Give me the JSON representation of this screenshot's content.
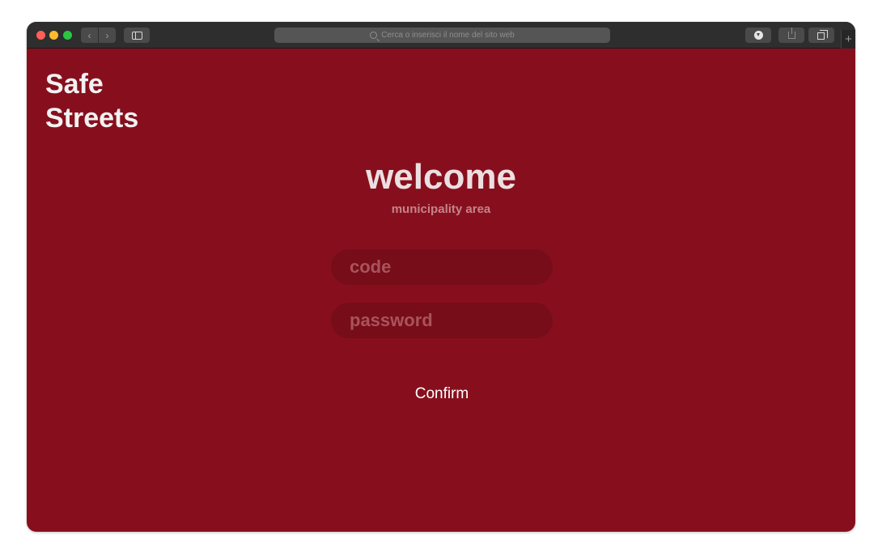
{
  "browser": {
    "address_placeholder": "Cerca o inserisci il nome del sito web",
    "new_tab_label": "+"
  },
  "page": {
    "brand_line1": "Safe",
    "brand_line2": "Streets",
    "title": "welcome",
    "subtitle": "municipality area",
    "code_placeholder": "code",
    "password_placeholder": "password",
    "confirm_label": "Confirm"
  },
  "colors": {
    "background": "#870f1d",
    "input_background": "#760d18",
    "toolbar": "#2e2e2e"
  }
}
